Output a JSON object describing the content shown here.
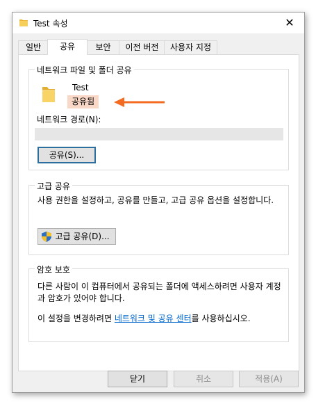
{
  "window": {
    "title": "Test 속성",
    "close_glyph": "✕"
  },
  "tabs": [
    {
      "label": "일반"
    },
    {
      "label": "공유",
      "active": true
    },
    {
      "label": "보안"
    },
    {
      "label": "이전 버전"
    },
    {
      "label": "사용자 지정"
    }
  ],
  "network_share": {
    "legend": "네트워크 파일 및 폴더 공유",
    "folder_name": "Test",
    "status": "공유됨",
    "path_label": "네트워크 경로(N):",
    "share_button": "공유(S)..."
  },
  "advanced_share": {
    "legend": "고급 공유",
    "description": "사용 권한을 설정하고, 공유를 만들고, 고급 공유 옵션을 설정합니다.",
    "button": "고급 공유(D)..."
  },
  "password": {
    "legend": "암호 보호",
    "description": "다른 사람이 이 컴퓨터에서 공유되는 폴더에 액세스하려면 사용자 계정과 암호가 있어야 합니다.",
    "change_prefix": "이 설정을 변경하려면 ",
    "link_text": "네트워크 및 공유 센터",
    "change_suffix": "를 사용하십시오."
  },
  "footer": {
    "close": "닫기",
    "cancel": "취소",
    "apply": "적용(A)"
  },
  "colors": {
    "arrow": "#f26b21",
    "badge": "#f9d8c8",
    "link": "#0066cc",
    "focus": "#2c6e9e"
  }
}
